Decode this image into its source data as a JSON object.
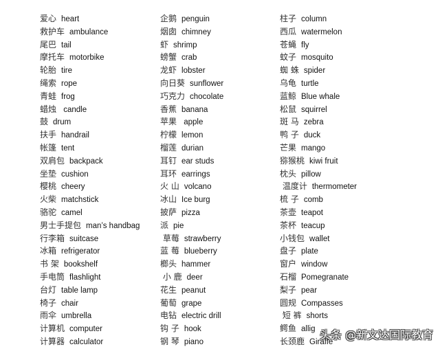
{
  "columns": [
    [
      {
        "zh": "爱心",
        "en": "heart"
      },
      {
        "zh": "救护车",
        "en": "ambulance"
      },
      {
        "zh": "尾巴",
        "en": "tail"
      },
      {
        "zh": "摩托车",
        "en": "motorbike"
      },
      {
        "zh": "轮胎",
        "en": "tire"
      },
      {
        "zh": "绳索",
        "en": "rope"
      },
      {
        "zh": "青蛙",
        "en": "frog"
      },
      {
        "zh": "蜡烛",
        "en": " candle"
      },
      {
        "zh": "鼓",
        "en": "drum"
      },
      {
        "zh": "扶手",
        "en": "handrail"
      },
      {
        "zh": "帐篷",
        "en": "tent"
      },
      {
        "zh": "双肩包",
        "en": "backpack"
      },
      {
        "zh": "坐垫",
        "en": "cushion"
      },
      {
        "zh": "樱桃",
        "en": "cheery"
      },
      {
        "zh": "火柴",
        "en": "matchstick"
      },
      {
        "zh": "骆驼",
        "en": "camel"
      },
      {
        "zh": "男士手提包",
        "en": "man’s handbag"
      },
      {
        "zh": "行李箱",
        "en": "suitcase"
      },
      {
        "zh": "冰箱",
        "en": "refrigerator"
      },
      {
        "zh": "书 架",
        "en": "bookshelf"
      },
      {
        "zh": "手电筒",
        "en": "flashlight"
      },
      {
        "zh": "台灯",
        "en": "table lamp"
      },
      {
        "zh": "椅子",
        "en": "chair"
      },
      {
        "zh": "雨伞",
        "en": "umbrella"
      },
      {
        "zh": "计算机",
        "en": "computer"
      },
      {
        "zh": "计算器",
        "en": "calculator"
      }
    ],
    [
      {
        "zh": "企鹅",
        "en": "penguin"
      },
      {
        "zh": "烟囱",
        "en": "chimney"
      },
      {
        "zh": "虾",
        "en": "shrimp"
      },
      {
        "zh": "螃蟹",
        "en": "crab"
      },
      {
        "zh": "龙虾",
        "en": "lobster"
      },
      {
        "zh": "向日葵",
        "en": "sunflower"
      },
      {
        "zh": "巧克力",
        "en": "chocolate"
      },
      {
        "zh": "香蕉",
        "en": "banana"
      },
      {
        "zh": "苹果",
        "en": " apple"
      },
      {
        "zh": "柠檬",
        "en": "lemon"
      },
      {
        "zh": "榴莲",
        "en": "durian"
      },
      {
        "zh": "耳钉",
        "en": "ear studs"
      },
      {
        "zh": "耳环",
        "en": "earrings"
      },
      {
        "zh": "火 山",
        "en": "volcano"
      },
      {
        "zh": "冰山",
        "en": "Ice burg"
      },
      {
        "zh": "披萨",
        "en": "pizza"
      },
      {
        "zh": "派",
        "en": "pie"
      },
      {
        "zh": " 草莓",
        "en": "strawberry"
      },
      {
        "zh": "蓝 莓",
        "en": "blueberry"
      },
      {
        "zh": "榔头",
        "en": "hammer"
      },
      {
        "zh": " 小 鹿",
        "en": "deer"
      },
      {
        "zh": "花生",
        "en": "peanut"
      },
      {
        "zh": "葡萄",
        "en": "grape"
      },
      {
        "zh": "电钻",
        "en": "electric drill"
      },
      {
        "zh": "钩 子",
        "en": "hook"
      },
      {
        "zh": "钢 琴",
        "en": "piano"
      }
    ],
    [
      {
        "zh": "柱子",
        "en": "column"
      },
      {
        "zh": "西瓜",
        "en": "watermelon"
      },
      {
        "zh": "苍蝇",
        "en": "fly"
      },
      {
        "zh": "蚊子",
        "en": "mosquito"
      },
      {
        "zh": "蜘 蛛",
        "en": "spider"
      },
      {
        "zh": "乌龟",
        "en": "turtle"
      },
      {
        "zh": "蓝鲸",
        "en": "Blue whale"
      },
      {
        "zh": "松鼠",
        "en": "squirrel"
      },
      {
        "zh": "斑 马",
        "en": "zebra"
      },
      {
        "zh": "鸭 子",
        "en": "duck"
      },
      {
        "zh": "芒果",
        "en": "mango"
      },
      {
        "zh": "猕猴桃",
        "en": "kiwi fruit"
      },
      {
        "zh": "枕头",
        "en": "pillow"
      },
      {
        "zh": " 温度计",
        "en": "thermometer"
      },
      {
        "zh": "梳 子",
        "en": "comb"
      },
      {
        "zh": "茶壶",
        "en": "teapot"
      },
      {
        "zh": "茶杯",
        "en": "teacup"
      },
      {
        "zh": "小钱包",
        "en": "wallet"
      },
      {
        "zh": "盘子",
        "en": "plate"
      },
      {
        "zh": "窗户",
        "en": "window"
      },
      {
        "zh": "石榴",
        "en": "Pomegranate"
      },
      {
        "zh": "梨子",
        "en": "pear"
      },
      {
        "zh": "圆规",
        "en": "Compasses"
      },
      {
        "zh": " 短 裤",
        "en": "shorts"
      },
      {
        "zh": "鳄鱼",
        "en": "allig"
      },
      {
        "zh": "长颈鹿",
        "en": "Giraffe"
      }
    ]
  ],
  "watermark": "头条 @新文达国际教育"
}
